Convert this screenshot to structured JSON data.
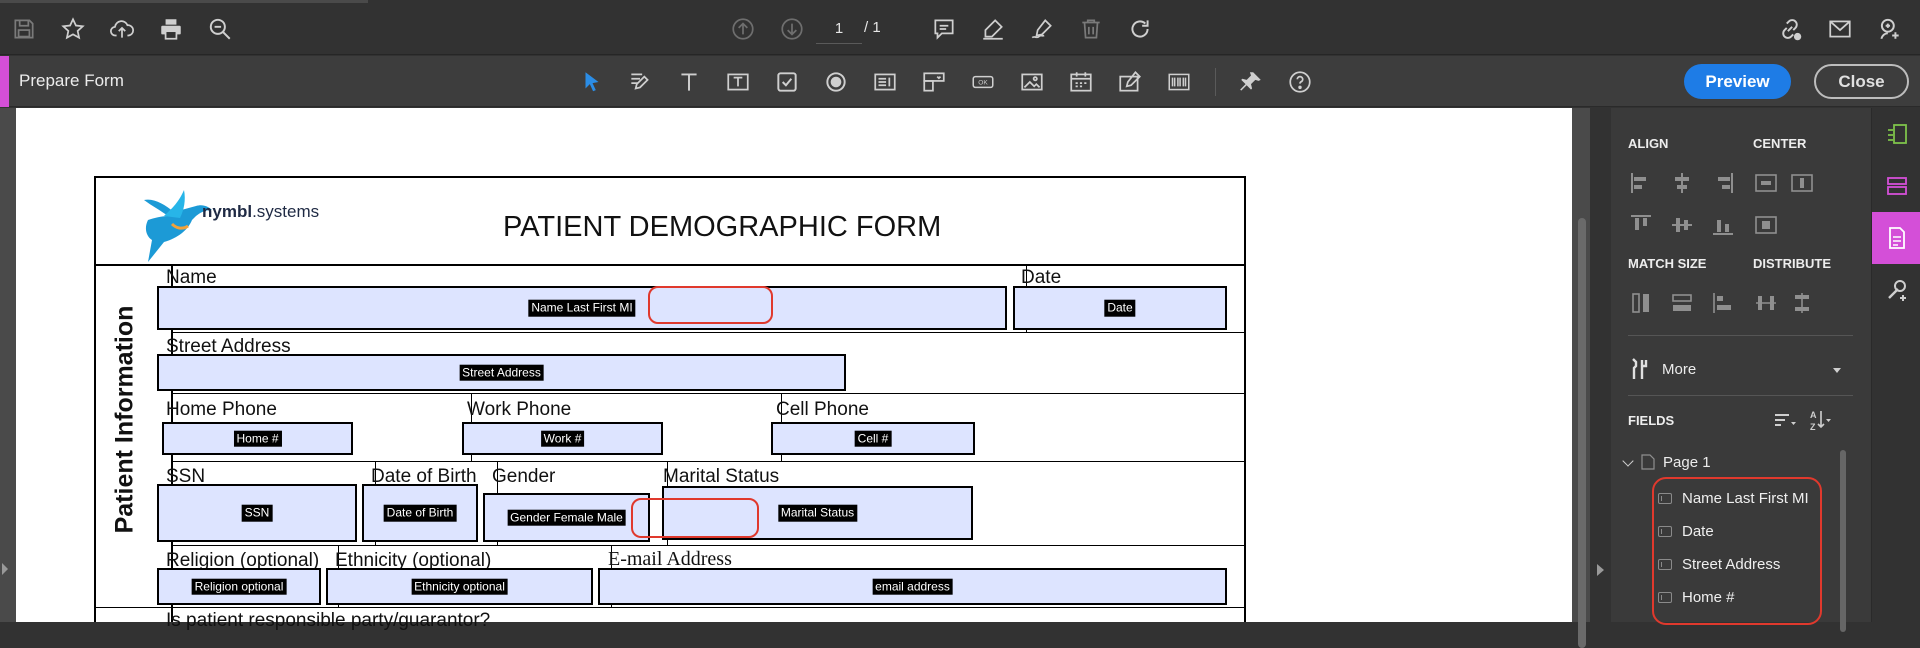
{
  "toolbar": {
    "page_current": "1",
    "page_total": "/ 1",
    "icons": [
      "save-icon",
      "star-icon",
      "upload-cloud-icon",
      "print-icon",
      "zoom-out-icon",
      "page-up-icon",
      "page-down-icon",
      "comment-icon",
      "highlight-pen-icon",
      "sign-pen-icon",
      "trash-icon",
      "rotate-icon",
      "share-link-icon",
      "mail-icon",
      "add-user-icon"
    ]
  },
  "prepare": {
    "title": "Prepare Form",
    "preview_label": "Preview",
    "close_label": "Close",
    "tools": [
      "select-arrow-icon",
      "edit-text-icon",
      "text-field-icon",
      "text-box-icon",
      "checkbox-icon",
      "radio-button-icon",
      "list-box-icon",
      "dropdown-icon",
      "button-ok-icon",
      "image-icon",
      "date-icon",
      "signature-icon",
      "barcode-icon",
      "pin-icon",
      "help-icon"
    ]
  },
  "form": {
    "logo_text_bold": "nymbl",
    "logo_text_rest": ".systems",
    "title": "PATIENT DEMOGRAPHIC FORM",
    "section_label": "Patient Information",
    "labels": {
      "name": "Name",
      "date": "Date",
      "street": "Street Address",
      "home_phone": "Home Phone",
      "work_phone": "Work Phone",
      "cell_phone": "Cell Phone",
      "ssn": "SSN",
      "dob": "Date of Birth",
      "gender": "Gender",
      "marital": "Marital Status",
      "religion": "Religion (optional)",
      "ethnicity": "Ethnicity (optional)",
      "email": "E-mail Address",
      "responsible": "Is patient responsible party/guarantor?"
    },
    "fields": {
      "name": "Name Last First MI",
      "date": "Date",
      "street": "Street Address",
      "home": "Home #",
      "work": "Work #",
      "cell": "Cell #",
      "ssn": "SSN",
      "dob": "Date of Birth",
      "gender": "Gender Female Male",
      "marital": "Marital Status",
      "religion": "Religion optional",
      "ethnicity": "Ethnicity optional",
      "email": "email address"
    }
  },
  "panel": {
    "align": "ALIGN",
    "center": "CENTER",
    "match_size": "MATCH SIZE",
    "distribute": "DISTRIBUTE",
    "more": "More",
    "fields_header": "FIELDS",
    "page_node": "Page 1",
    "field_list": [
      "Name Last First MI",
      "Date",
      "Street Address",
      "Home #"
    ]
  },
  "colors": {
    "accent_magenta": "#d44fd8",
    "preview_blue": "#1e7ce6",
    "field_fill": "#dde4ff",
    "highlight_red": "#e0392d"
  }
}
